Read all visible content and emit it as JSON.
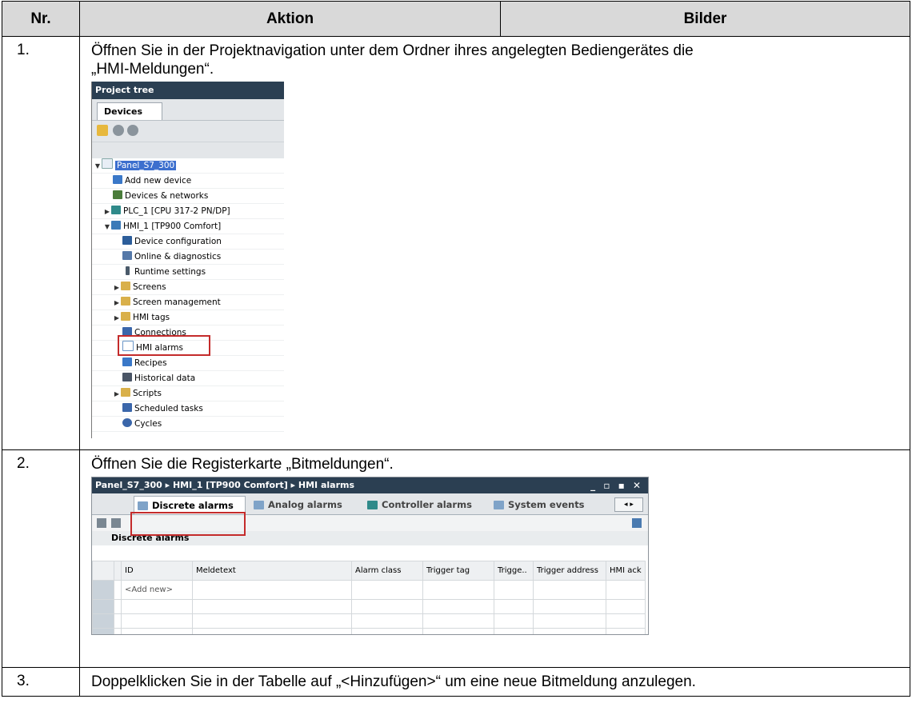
{
  "header": {
    "nr": "Nr.",
    "aktion": "Aktion",
    "bilder": "Bilder"
  },
  "steps": [
    {
      "nr": "1.",
      "text": "Öffnen Sie in der Projektnavigation unter dem Ordner ihres angelegten Bediengerätes die „HMI-Meldungen“."
    },
    {
      "nr": "2.",
      "text": "Öffnen Sie die Registerkarte „Bitmeldungen“."
    },
    {
      "nr": "3.",
      "text": "Doppelklicken Sie in der Tabelle auf „<Hinzufügen>“ um eine neue Bitmeldung anzulegen."
    }
  ],
  "project_tree": {
    "title": "Project tree",
    "tab": "Devices",
    "items": [
      {
        "label": "Panel_S7_300",
        "icon": "document-icon",
        "color": "#e8eef6"
      },
      {
        "label": "Add new device",
        "icon": "add-device-icon",
        "color": "#3a78c8"
      },
      {
        "label": "Devices & networks",
        "icon": "network-icon",
        "color": "#4a7c3a"
      },
      {
        "label": "PLC_1 [CPU 317-2 PN/DP]",
        "icon": "plc-icon",
        "color": "#2f8a8a"
      },
      {
        "label": "HMI_1 [TP900 Comfort]",
        "icon": "hmi-icon",
        "color": "#3b7ab8"
      },
      {
        "label": "Device configuration",
        "icon": "device-config-icon",
        "color": "#2c5d9a"
      },
      {
        "label": "Online & diagnostics",
        "icon": "diagnostics-icon",
        "color": "#5578a8"
      },
      {
        "label": "Runtime settings",
        "icon": "runtime-settings-icon",
        "color": "#4a5a6a"
      },
      {
        "label": "Screens",
        "icon": "folder-icon",
        "color": "#d9b04a"
      },
      {
        "label": "Screen management",
        "icon": "folder-icon",
        "color": "#d9b04a"
      },
      {
        "label": "HMI tags",
        "icon": "folder-icon",
        "color": "#d9b04a"
      },
      {
        "label": "Connections",
        "icon": "connections-icon",
        "color": "#3a66aa"
      },
      {
        "label": "HMI alarms",
        "icon": "envelope-icon",
        "color": "#6a96c8"
      },
      {
        "label": "Recipes",
        "icon": "recipes-icon",
        "color": "#3a78c8"
      },
      {
        "label": "Historical data",
        "icon": "historical-data-icon",
        "color": "#4a5566"
      },
      {
        "label": "Scripts",
        "icon": "folder-icon",
        "color": "#d9b04a"
      },
      {
        "label": "Scheduled tasks",
        "icon": "scheduled-tasks-icon",
        "color": "#3a66aa"
      },
      {
        "label": "Cycles",
        "icon": "cycles-icon",
        "color": "#3a66aa"
      }
    ]
  },
  "alarms_window": {
    "breadcrumb": "Panel_S7_300  ▸  HMI_1 [TP900 Comfort]  ▸  HMI alarms",
    "window_controls": "_ ▫ ▪ ✕",
    "tabs": [
      "Discrete alarms",
      "Analog alarms",
      "Controller alarms",
      "System events"
    ],
    "tab_nav": "◂ ▸",
    "section_title": "Discrete alarms",
    "columns": [
      "ID",
      "Meldetext",
      "Alarm class",
      "Trigger tag",
      "Trigge..",
      "Trigger address",
      "HMI ack"
    ],
    "add_new": "<Add new>"
  }
}
